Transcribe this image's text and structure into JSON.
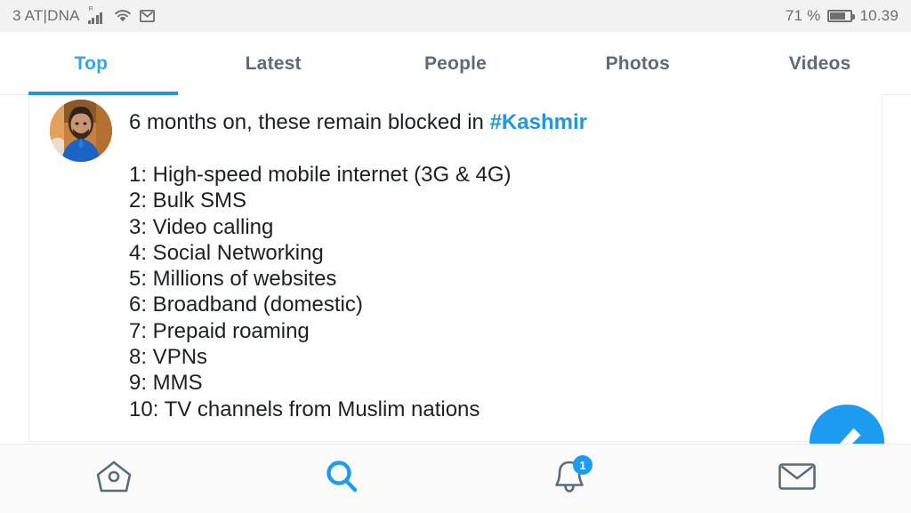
{
  "statusbar": {
    "carrier": "3 AT|DNA",
    "signal_icon": "signal-bars-roaming-icon",
    "wifi_icon": "wifi-icon",
    "mail_icon": "gmail-icon",
    "battery_percent": "71 %",
    "battery_icon": "battery-icon",
    "clock": "10.39"
  },
  "tabs": [
    {
      "label": "Top",
      "active": true
    },
    {
      "label": "Latest",
      "active": false
    },
    {
      "label": "People",
      "active": false
    },
    {
      "label": "Photos",
      "active": false
    },
    {
      "label": "Videos",
      "active": false
    }
  ],
  "tweet": {
    "avatar_alt": "profile-photo",
    "headline_text": "6 months on, these remain blocked in ",
    "hashtag": "#Kashmir",
    "items": [
      "1: High-speed mobile internet (3G & 4G)",
      "2: Bulk SMS",
      "3: Video calling",
      "4: Social Networking",
      "5: Millions of websites",
      "6: Broadband (domestic)",
      "7: Prepaid roaming",
      "8: VPNs",
      "9: MMS",
      "10: TV channels from Muslim nations"
    ]
  },
  "fab": {
    "icon": "compose-tweet-icon"
  },
  "bottomnav": [
    {
      "icon": "home-icon",
      "active": false,
      "badge": ""
    },
    {
      "icon": "search-icon",
      "active": true,
      "badge": ""
    },
    {
      "icon": "bell-icon",
      "active": false,
      "badge": "1"
    },
    {
      "icon": "mail-icon",
      "active": false,
      "badge": ""
    }
  ],
  "colors": {
    "accent": "#1d9bf0",
    "tab_active": "#37a6e6",
    "tab_inactive": "#5b6b7c",
    "text": "#1c2022",
    "statusbar_bg": "#f2f2f2"
  }
}
